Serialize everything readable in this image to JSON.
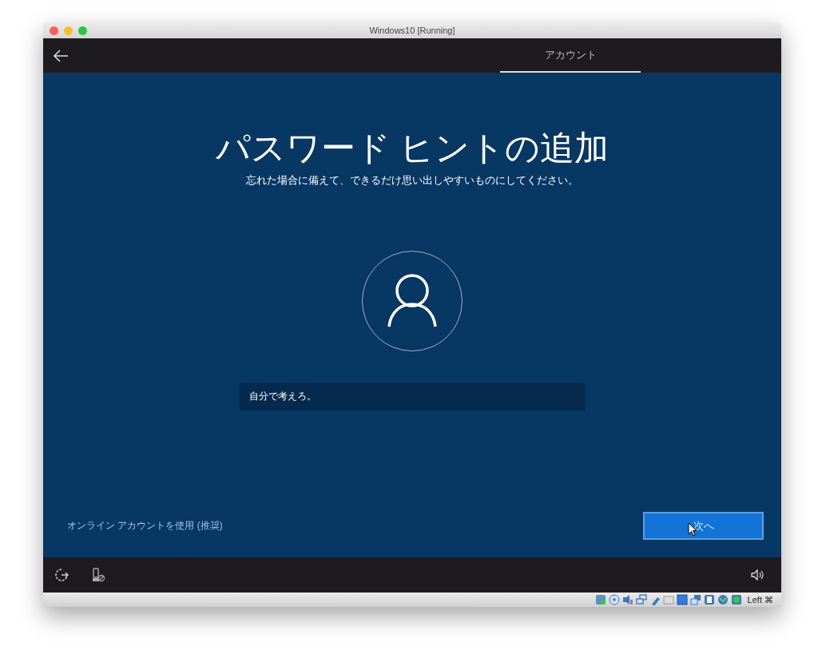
{
  "window": {
    "title": "Windows10 [Running]"
  },
  "header": {
    "tabs": [
      {
        "label": "アカウント",
        "selected": true
      }
    ]
  },
  "heading": "パスワード ヒントの追加",
  "subtitle": "忘れた場合に備えて、できるだけ思い出しやすいものにしてください。",
  "hint_field": {
    "value": "自分で考えろ。"
  },
  "link": "オンライン アカウントを使用 (推奨)",
  "next_button": "次へ",
  "status_bar": {
    "text": "Left ⌘"
  }
}
